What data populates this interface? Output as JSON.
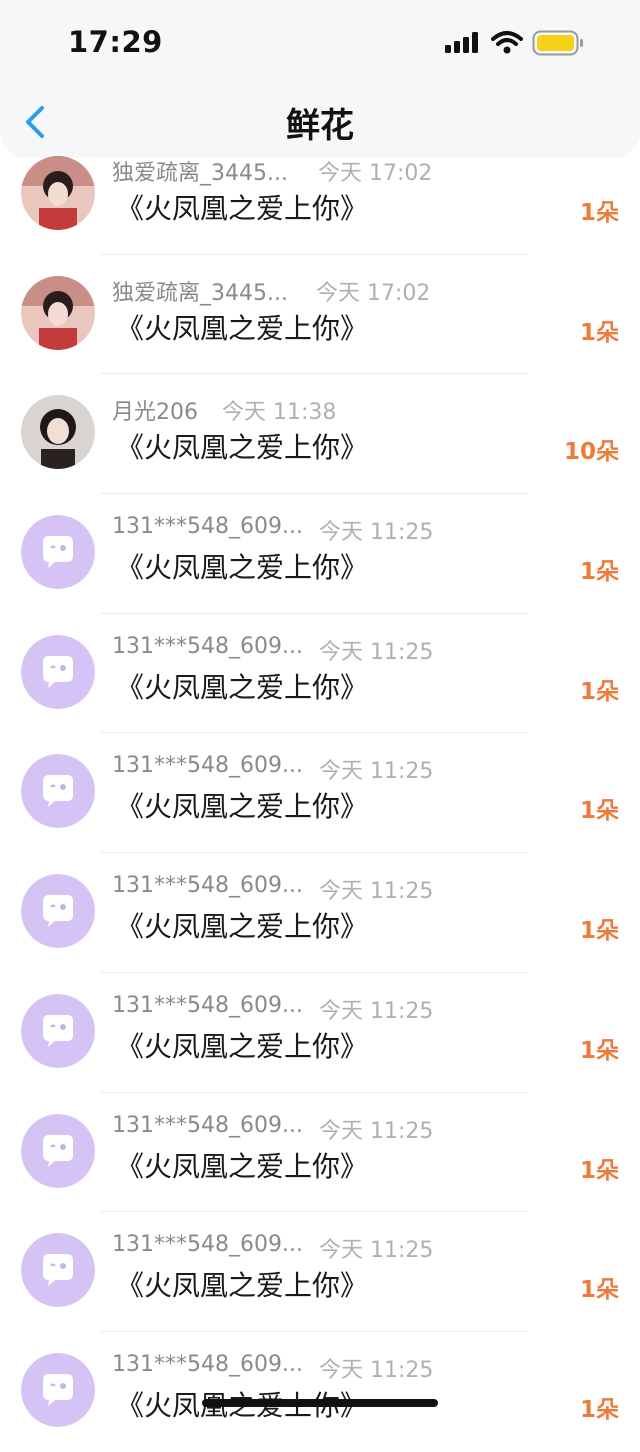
{
  "status_bar": {
    "time": "17:29",
    "battery_color": "#f7d117"
  },
  "header": {
    "title": "鲜花"
  },
  "accent_colors": {
    "count": "#ef7b3a",
    "placeholder_avatar": "#d6c3f6"
  },
  "rows": [
    {
      "name": "独爱疏离_3445...",
      "time": "今天 17:02",
      "gift": "《火凤凰之爱上你》",
      "count": "1朵"
    },
    {
      "name": "独爱疏离_3445...",
      "time": "今天 17:02",
      "gift": "《火凤凰之爱上你》",
      "count": "1朵"
    },
    {
      "name": "月光206",
      "time": "今天 11:38",
      "gift": "《火凤凰之爱上你》",
      "count": "10朵"
    },
    {
      "name": "131***548_609...",
      "time": "今天 11:25",
      "gift": "《火凤凰之爱上你》",
      "count": "1朵"
    },
    {
      "name": "131***548_609...",
      "time": "今天 11:25",
      "gift": "《火凤凰之爱上你》",
      "count": "1朵"
    },
    {
      "name": "131***548_609...",
      "time": "今天 11:25",
      "gift": "《火凤凰之爱上你》",
      "count": "1朵"
    },
    {
      "name": "131***548_609...",
      "time": "今天 11:25",
      "gift": "《火凤凰之爱上你》",
      "count": "1朵"
    },
    {
      "name": "131***548_609...",
      "time": "今天 11:25",
      "gift": "《火凤凰之爱上你》",
      "count": "1朵"
    },
    {
      "name": "131***548_609...",
      "time": "今天 11:25",
      "gift": "《火凤凰之爱上你》",
      "count": "1朵"
    },
    {
      "name": "131***548_609...",
      "time": "今天 11:25",
      "gift": "《火凤凰之爱上你》",
      "count": "1朵"
    },
    {
      "name": "131***548_609...",
      "time": "今天 11:25",
      "gift": "《火凤凰之爱上你》",
      "count": "1朵"
    }
  ]
}
